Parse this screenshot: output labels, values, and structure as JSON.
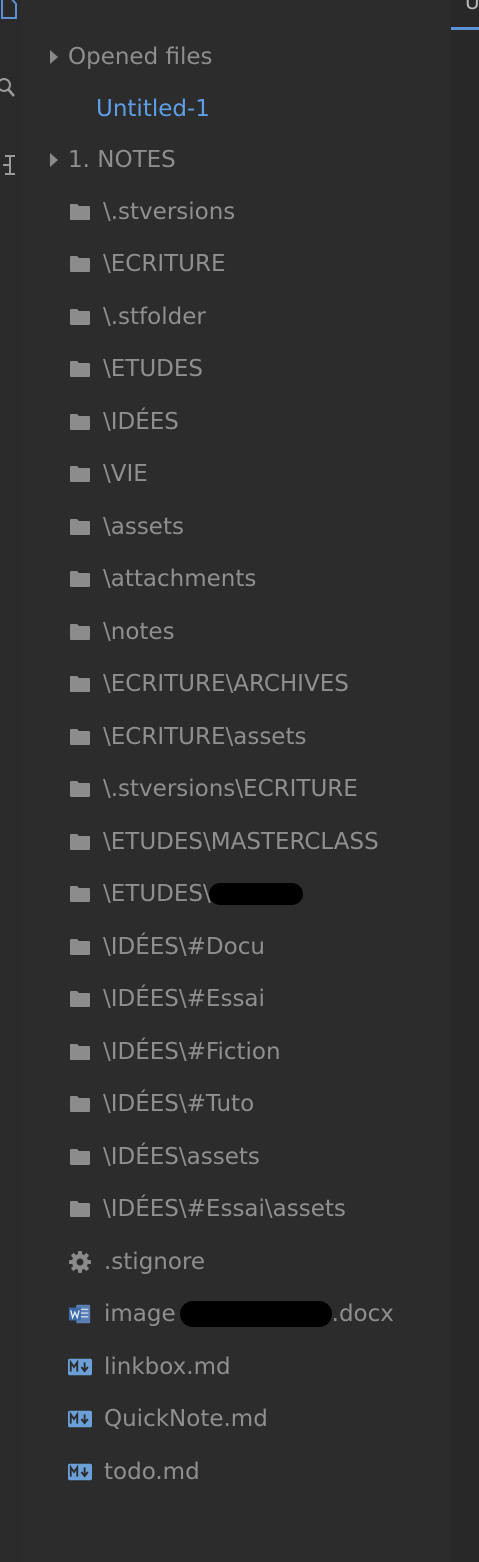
{
  "sidebar": {
    "opened_files": {
      "label": "Opened files",
      "items": [
        {
          "label": "Untitled-1"
        }
      ]
    },
    "notes": {
      "label": "1. NOTES"
    },
    "folders": [
      {
        "label": "\\.stversions"
      },
      {
        "label": "\\ECRITURE"
      },
      {
        "label": "\\.stfolder"
      },
      {
        "label": "\\ETUDES"
      },
      {
        "label": "\\IDÉES"
      },
      {
        "label": "\\VIE"
      },
      {
        "label": "\\assets"
      },
      {
        "label": "\\attachments"
      },
      {
        "label": "\\notes"
      },
      {
        "label": "\\ECRITURE\\ARCHIVES"
      },
      {
        "label": "\\ECRITURE\\assets"
      },
      {
        "label": "\\.stversions\\ECRITURE"
      },
      {
        "label": "\\ETUDES\\MASTERCLASS"
      },
      {
        "label": "\\ETUDES\\"
      },
      {
        "label": "\\IDÉES\\#Docu"
      },
      {
        "label": "\\IDÉES\\#Essai"
      },
      {
        "label": "\\IDÉES\\#Fiction"
      },
      {
        "label": "\\IDÉES\\#Tuto"
      },
      {
        "label": "\\IDÉES\\assets"
      },
      {
        "label": "\\IDÉES\\#Essai\\assets"
      }
    ],
    "files": [
      {
        "label": ".stignore",
        "icon": "gear-icon"
      },
      {
        "label_start": "image",
        "label_end": ".docx",
        "icon": "word-document-icon"
      },
      {
        "label": "linkbox.md",
        "icon": "markdown-icon"
      },
      {
        "label": "QuickNote.md",
        "icon": "markdown-icon"
      },
      {
        "label": "todo.md",
        "icon": "markdown-icon"
      }
    ]
  },
  "editor": {
    "tab_glyph": "U"
  },
  "colors": {
    "background": "#2c2c2c",
    "text_muted": "#8f8f8f",
    "accent_blue": "#5d9ee7",
    "folder_icon": "#8c8c8c",
    "markdown_icon": "#6b9fd8"
  }
}
